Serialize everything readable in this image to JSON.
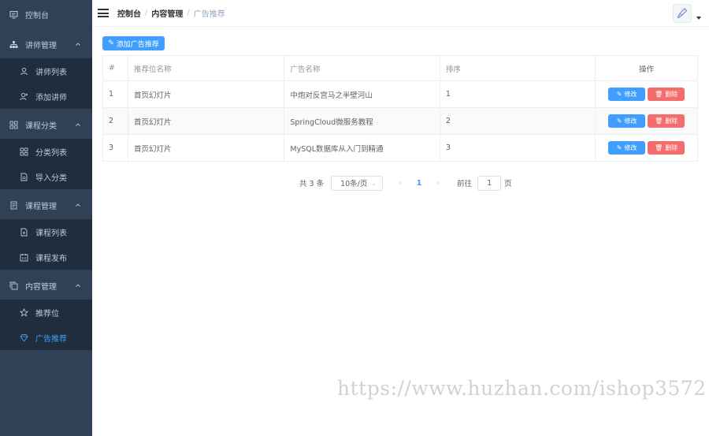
{
  "sidebar": {
    "dashboard": "控制台",
    "groups": [
      {
        "label": "讲师管理",
        "items": [
          "讲师列表",
          "添加讲师"
        ]
      },
      {
        "label": "课程分类",
        "items": [
          "分类列表",
          "导入分类"
        ]
      },
      {
        "label": "课程管理",
        "items": [
          "课程列表",
          "课程发布"
        ]
      },
      {
        "label": "内容管理",
        "items": [
          "推荐位",
          "广告推荐"
        ]
      }
    ],
    "active_item": "广告推荐",
    "colors": {
      "background": "#304156",
      "submenu": "#1f2d3d",
      "text": "#bfcbd9",
      "active": "#409eff"
    }
  },
  "header": {
    "breadcrumb": [
      "控制台",
      "内容管理",
      "广告推荐"
    ]
  },
  "toolbar": {
    "add_label": "添加广告推荐"
  },
  "table": {
    "columns": [
      "#",
      "推荐位名称",
      "广告名称",
      "排序",
      "操作"
    ],
    "rows": [
      {
        "index": "1",
        "position": "首页幻灯片",
        "name": "中炮对反宫马之半壁河山",
        "sort": "1"
      },
      {
        "index": "2",
        "position": "首页幻灯片",
        "name": "SpringCloud微服务教程",
        "sort": "2"
      },
      {
        "index": "3",
        "position": "首页幻灯片",
        "name": "MySQL数据库从入门到精通",
        "sort": "3"
      }
    ],
    "edit_label": "修改",
    "delete_label": "删除"
  },
  "pagination": {
    "total": "共 3 条",
    "page_size": "10条/页",
    "current_page": "1",
    "goto_prefix": "前往",
    "goto_value": "1",
    "goto_suffix": "页"
  },
  "watermark": "https://www.huzhan.com/ishop3572",
  "colors": {
    "primary": "#409eff",
    "danger": "#f56c6c"
  }
}
